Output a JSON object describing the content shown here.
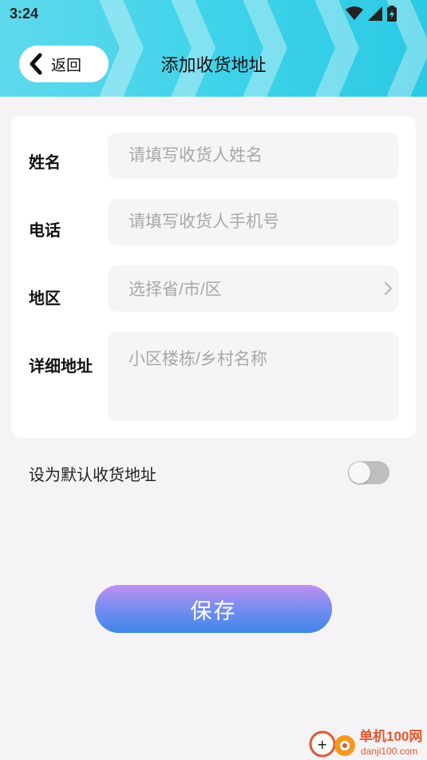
{
  "status_bar": {
    "time": "3:24",
    "icons": [
      "wifi-icon",
      "cellular-signal-icon",
      "battery-charging-icon"
    ]
  },
  "header": {
    "back_label": "返回",
    "title": "添加收货地址",
    "background_color": "#3fd3ea"
  },
  "form": {
    "name": {
      "label": "姓名",
      "placeholder": "请填写收货人姓名",
      "value": ""
    },
    "phone": {
      "label": "电话",
      "placeholder": "请填写收货人手机号",
      "value": ""
    },
    "region": {
      "label": "地区",
      "placeholder": "选择省/市/区",
      "value": ""
    },
    "detail": {
      "label": "详细地址",
      "placeholder": "小区楼栋/乡村名称",
      "value": ""
    }
  },
  "default_address": {
    "label": "设为默认收货地址",
    "enabled": false
  },
  "save": {
    "label": "保存",
    "gradient": [
      "#c48ff0",
      "#3f86e8"
    ]
  },
  "watermark": {
    "title": "单机100网",
    "url": "danji100.com"
  }
}
